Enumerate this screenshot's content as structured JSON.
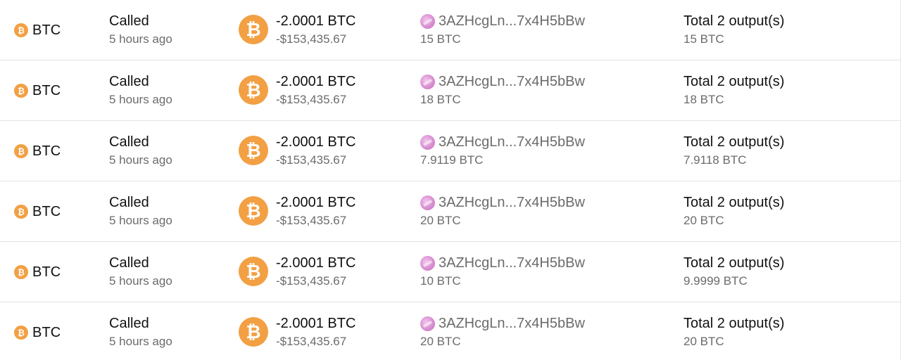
{
  "colors": {
    "btc_orange": "#f2a043",
    "text_primary": "#111111",
    "text_secondary": "#6b6b6b",
    "divider": "#e3e3e3"
  },
  "icons": {
    "asset": "bitcoin-icon",
    "amount": "bitcoin-icon",
    "from": "address-avatar-icon"
  },
  "rows": [
    {
      "asset": "BTC",
      "method": "Called",
      "time": "5 hours ago",
      "amount": "-2.0001 BTC",
      "amount_usd": "-$153,435.67",
      "from_address": "3AZHcgLn...7x4H5bBw",
      "from_amount": "15 BTC",
      "to_summary": "Total 2 output(s)",
      "to_amount": "15 BTC"
    },
    {
      "asset": "BTC",
      "method": "Called",
      "time": "5 hours ago",
      "amount": "-2.0001 BTC",
      "amount_usd": "-$153,435.67",
      "from_address": "3AZHcgLn...7x4H5bBw",
      "from_amount": "18 BTC",
      "to_summary": "Total 2 output(s)",
      "to_amount": "18 BTC"
    },
    {
      "asset": "BTC",
      "method": "Called",
      "time": "5 hours ago",
      "amount": "-2.0001 BTC",
      "amount_usd": "-$153,435.67",
      "from_address": "3AZHcgLn...7x4H5bBw",
      "from_amount": "7.9119 BTC",
      "to_summary": "Total 2 output(s)",
      "to_amount": "7.9118 BTC"
    },
    {
      "asset": "BTC",
      "method": "Called",
      "time": "5 hours ago",
      "amount": "-2.0001 BTC",
      "amount_usd": "-$153,435.67",
      "from_address": "3AZHcgLn...7x4H5bBw",
      "from_amount": "20 BTC",
      "to_summary": "Total 2 output(s)",
      "to_amount": "20 BTC"
    },
    {
      "asset": "BTC",
      "method": "Called",
      "time": "5 hours ago",
      "amount": "-2.0001 BTC",
      "amount_usd": "-$153,435.67",
      "from_address": "3AZHcgLn...7x4H5bBw",
      "from_amount": "10 BTC",
      "to_summary": "Total 2 output(s)",
      "to_amount": "9.9999 BTC"
    },
    {
      "asset": "BTC",
      "method": "Called",
      "time": "5 hours ago",
      "amount": "-2.0001 BTC",
      "amount_usd": "-$153,435.67",
      "from_address": "3AZHcgLn...7x4H5bBw",
      "from_amount": "20 BTC",
      "to_summary": "Total 2 output(s)",
      "to_amount": "20 BTC"
    }
  ]
}
